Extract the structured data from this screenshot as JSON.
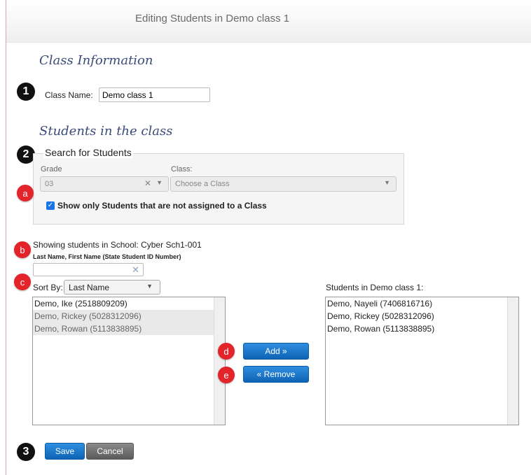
{
  "window": {
    "title": "Editing Students in Demo class 1"
  },
  "class_info": {
    "heading": "Class Information",
    "class_name_label": "Class Name:",
    "class_name_value": "Demo class 1"
  },
  "students_section": {
    "heading": "Students in the class"
  },
  "search": {
    "legend": "Search for Students",
    "grade_label": "Grade",
    "grade_value": "03",
    "class_label": "Class:",
    "class_placeholder": "Choose a Class",
    "only_unassigned_label": "Show only Students that are not assigned to a Class",
    "only_unassigned_checked": true
  },
  "filter": {
    "showing_text": "Showing students in School: Cyber Sch1-001",
    "name_hint": "Last Name, First Name (State Student ID Number)",
    "sort_label": "Sort By:",
    "sort_value": "Last Name"
  },
  "available_students": [
    {
      "name": "Demo, Ike (2518809209)",
      "greyed": false
    },
    {
      "name": "Demo, Rickey (5028312096)",
      "greyed": true
    },
    {
      "name": "Demo, Rowan (5113838895)",
      "greyed": true
    }
  ],
  "class_students": {
    "heading": "Students in Demo class 1:",
    "items": [
      "Demo, Nayeli (7406816716)",
      "Demo, Rickey (5028312096)",
      "Demo, Rowan (5113838895)"
    ]
  },
  "buttons": {
    "add": "Add »",
    "remove": "« Remove",
    "save": "Save",
    "cancel": "Cancel"
  },
  "markers": {
    "one": "1",
    "two": "2",
    "three": "3",
    "a": "a",
    "b": "b",
    "c": "c",
    "d": "d",
    "e": "e"
  },
  "colors": {
    "primary_button": "#1a73c8",
    "secondary_button": "#666666",
    "heading": "#3b4b7a",
    "marker_red": "#e3242b"
  }
}
